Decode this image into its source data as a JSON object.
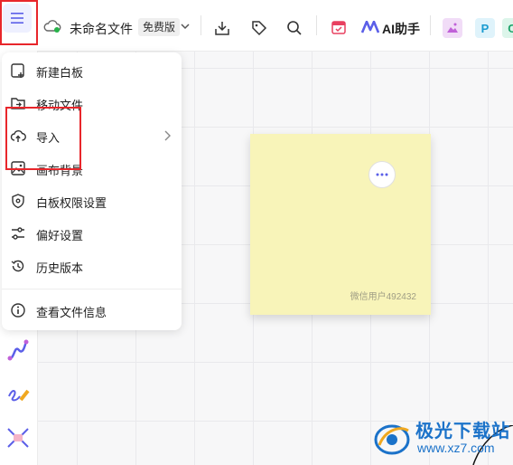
{
  "toolbar": {
    "file_name": "未命名文件",
    "plan_badge": "免费版",
    "ai_label": "AI助手",
    "p_label": "P",
    "c_label": "C"
  },
  "menu": {
    "items": [
      {
        "label": "新建白板",
        "icon": "new-board-icon"
      },
      {
        "label": "移动文件",
        "icon": "move-folder-icon"
      },
      {
        "label": "导入",
        "icon": "cloud-upload-icon",
        "has_submenu": true
      },
      {
        "label": "画布背景",
        "icon": "image-icon"
      },
      {
        "label": "白板权限设置",
        "icon": "lock-permission-icon"
      },
      {
        "label": "偏好设置",
        "icon": "sliders-icon"
      },
      {
        "label": "历史版本",
        "icon": "history-icon"
      },
      {
        "label": "查看文件信息",
        "icon": "info-icon"
      }
    ]
  },
  "canvas": {
    "sticky_note": {
      "author": "微信用户492432",
      "color": "#f8f4b9"
    }
  },
  "watermark": {
    "title": "极光下载站",
    "url": "www.xz7.com"
  },
  "colors": {
    "highlight": "#e8262b",
    "accent": "#5b5fe8",
    "sticky": "#f8f4b9"
  }
}
